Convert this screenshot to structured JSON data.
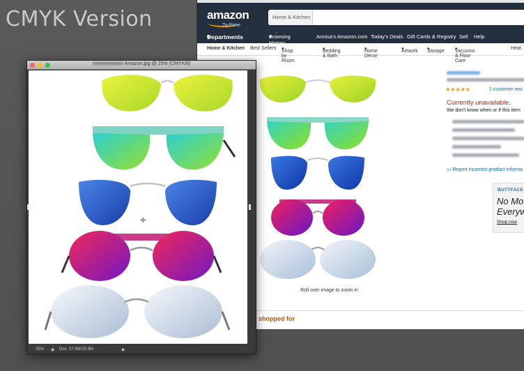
{
  "caption": "CMYK Version",
  "amazon": {
    "logo": "amazon",
    "prime_tag": "Try Prime",
    "search_category": "Home & Kitchen",
    "departments_label": "Departments",
    "nav_links": [
      "Browsing History",
      "Annisa's Amazon.com",
      "Today's Deals",
      "Gift Cards & Registry",
      "Sell",
      "Help"
    ],
    "subnav": [
      "Home & Kitchen",
      "Best Sellers",
      "Shop by Room",
      "Bedding & Bath",
      "Home Décor",
      "Artwork",
      "Storage",
      "Vacuums & Floor Care",
      "Heat"
    ],
    "zoom_hint": "Roll over image to zoom in",
    "shopped_for": "shopped for",
    "stars": "★★★★★",
    "reviews_link": "1 customer revi",
    "unavailable": "Currently unavailable.",
    "unavailable_sub": "We don't know when or if this item",
    "report_link": "Report incorrect product informa",
    "ad": {
      "brand": "BUTTFACE",
      "line1": "No Mo",
      "line2": "Everyw",
      "shop": "Shop now"
    }
  },
  "photoshop": {
    "title": "Amazon.jpg @ 25% (CMYK/8)",
    "zoom": "25%",
    "doc_info": "Doc: 27.9M/25.9M"
  },
  "colors": {
    "amazon_header": "#232f3e",
    "amazon_orange": "#ff9900",
    "unavailable_red": "#b12704",
    "link_blue": "#0066c0"
  }
}
